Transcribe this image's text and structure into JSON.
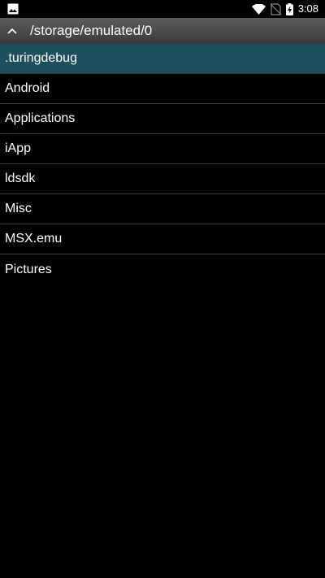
{
  "status_bar": {
    "time": "3:08",
    "icons": [
      "image-icon",
      "wifi-icon",
      "no-sim-icon",
      "battery-charging-icon"
    ]
  },
  "header": {
    "path": "/storage/emulated/0",
    "up_icon": "chevron-up-icon"
  },
  "files": [
    {
      "name": ".turingdebug",
      "selected": true
    },
    {
      "name": "Android"
    },
    {
      "name": "Applications"
    },
    {
      "name": "iApp"
    },
    {
      "name": "ldsdk"
    },
    {
      "name": "Misc"
    },
    {
      "name": "MSX.emu"
    },
    {
      "name": "Pictures"
    }
  ],
  "colors": {
    "selected_row": "#1e4f5f",
    "background": "#000000",
    "divider": "#3c3c3c"
  }
}
